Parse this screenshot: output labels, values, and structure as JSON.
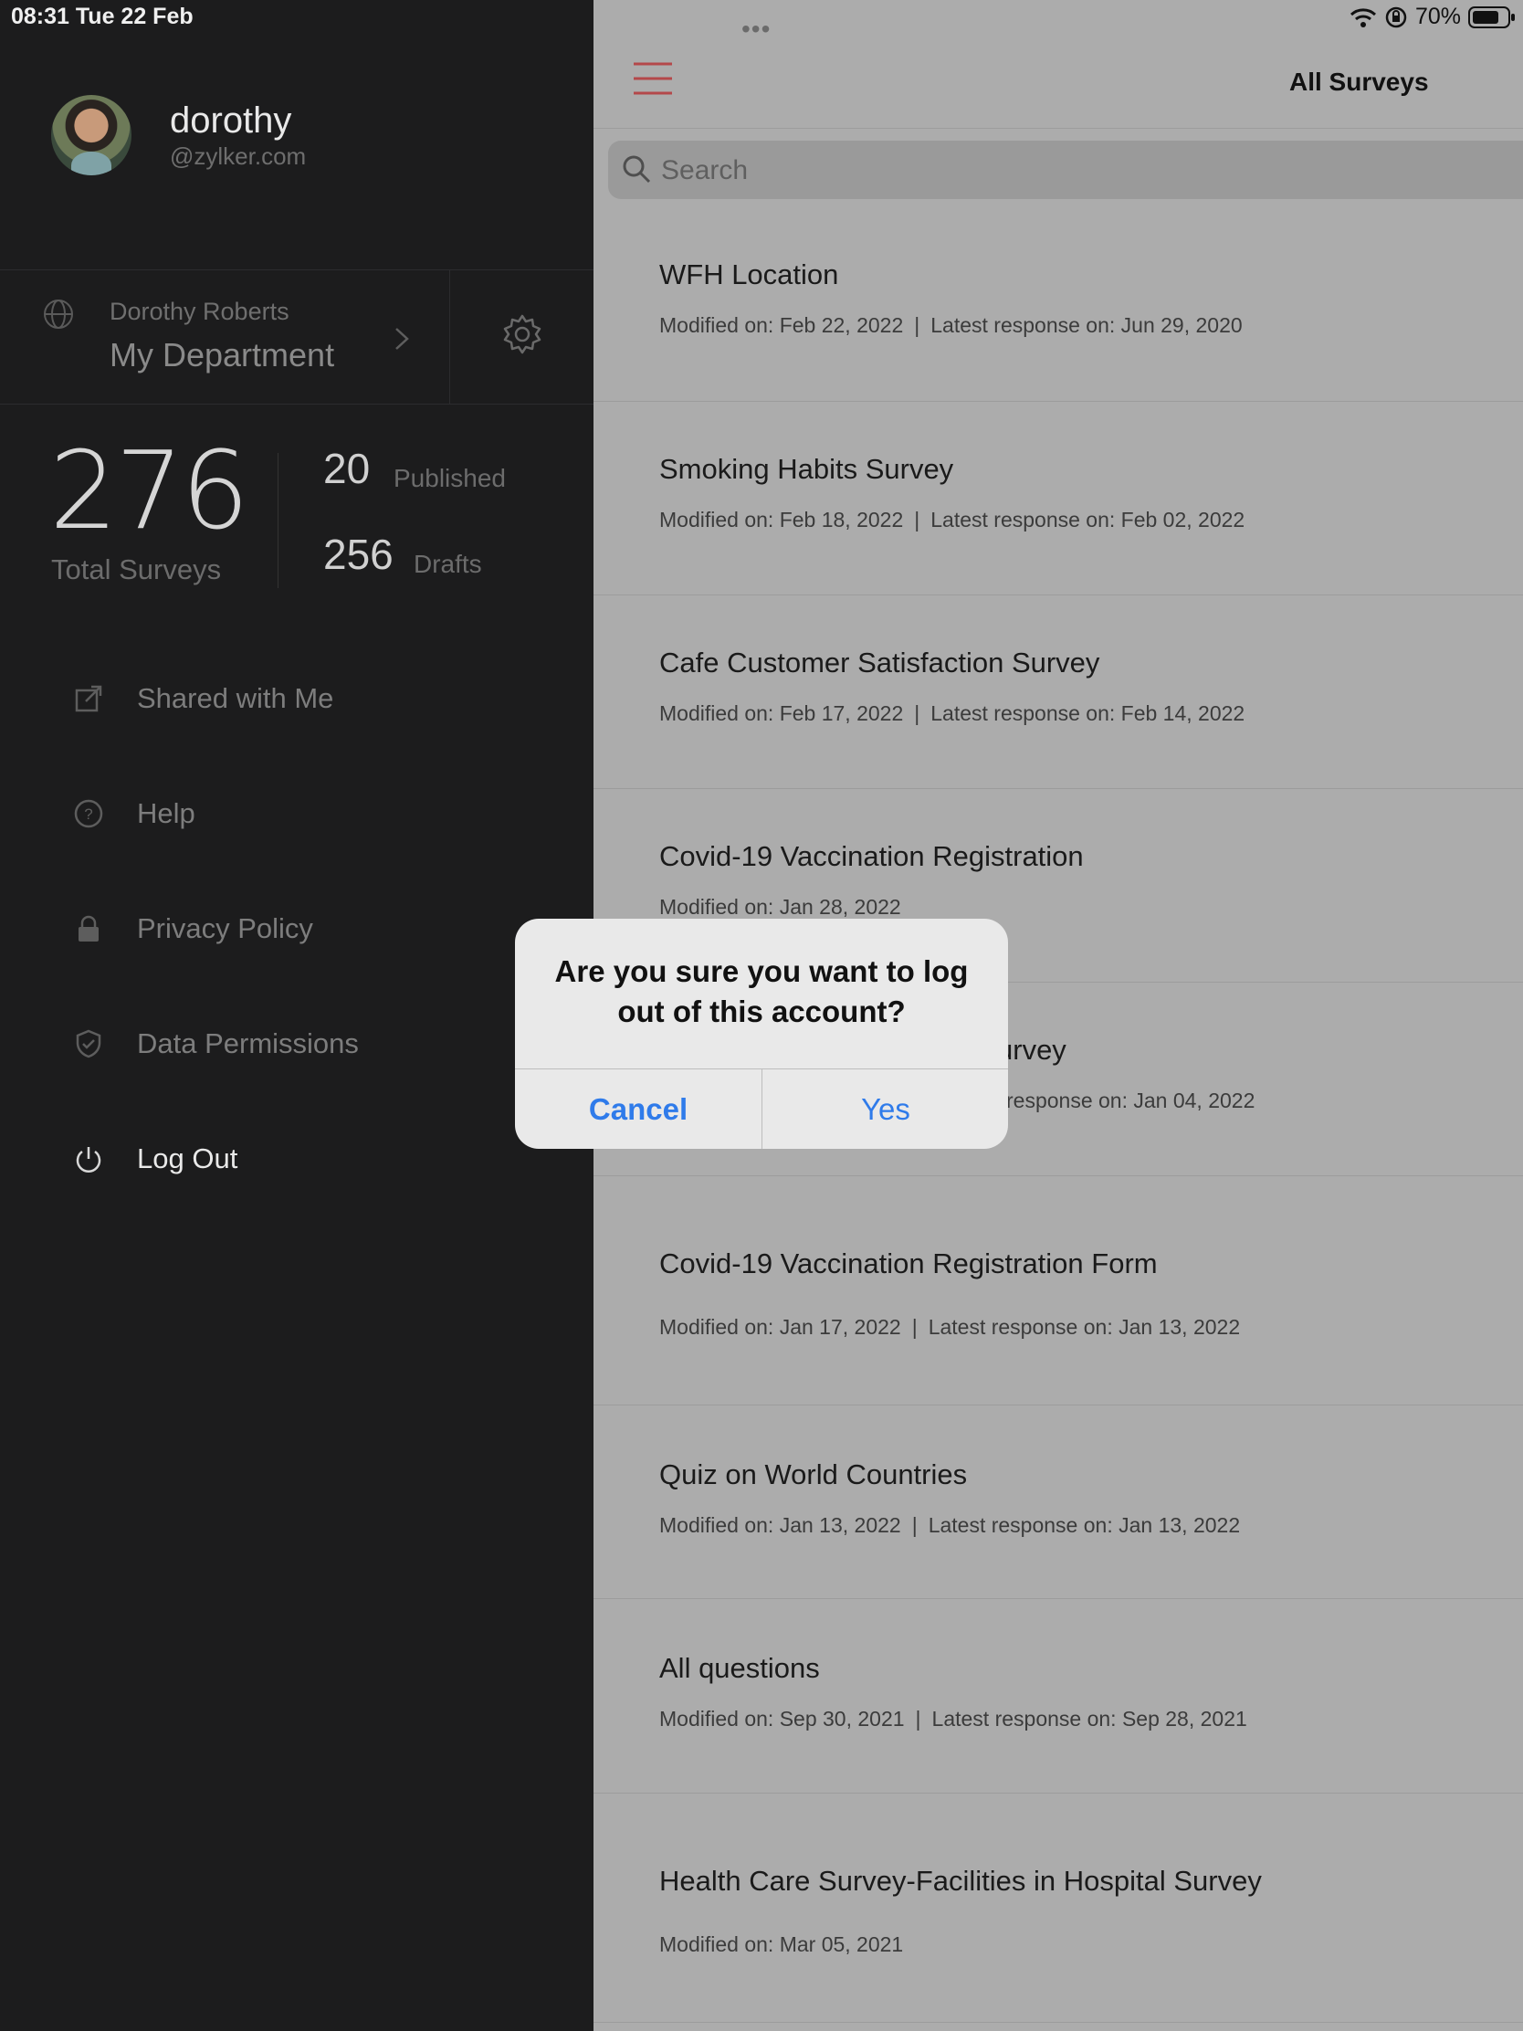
{
  "status_bar": {
    "time": "08:31   Tue 22 Feb",
    "battery": "70%"
  },
  "profile": {
    "name": "dorothy",
    "domain": "@zylker.com"
  },
  "department": {
    "owner": "Dorothy Roberts",
    "name": "My Department"
  },
  "stats": {
    "total": "276",
    "total_label": "Total Surveys",
    "published": "20",
    "published_label": "Published",
    "drafts": "256",
    "drafts_label": "Drafts"
  },
  "menu": [
    {
      "label": "Shared with Me",
      "icon": "share-icon"
    },
    {
      "label": "Help",
      "icon": "help-icon"
    },
    {
      "label": "Privacy Policy",
      "icon": "lock-icon"
    },
    {
      "label": "Data Permissions",
      "icon": "shield-icon"
    },
    {
      "label": "Log Out",
      "icon": "power-icon"
    }
  ],
  "header": {
    "title": "All Surveys",
    "grabber": "•••"
  },
  "search": {
    "placeholder": "Search"
  },
  "surveys": [
    {
      "title": "WFH Location",
      "modified": "Modified on: Feb 22, 2022",
      "latest": "Latest response on: Jun 29, 2020"
    },
    {
      "title": "Smoking Habits Survey",
      "modified": "Modified on: Feb 18, 2022",
      "latest": "Latest response on: Feb 02, 2022"
    },
    {
      "title": "Cafe Customer Satisfaction Survey",
      "modified": "Modified on: Feb 17, 2022",
      "latest": "Latest response on: Feb 14, 2022"
    },
    {
      "title": "Covid-19 Vaccination Registration",
      "modified": "Modified on: Jan 28, 2022",
      "latest": ""
    },
    {
      "title": "urvey",
      "modified": "",
      "latest": "response on: Jan 04, 2022"
    },
    {
      "title": "Covid-19 Vaccination Registration Form",
      "modified": "Modified on: Jan 17, 2022",
      "latest": "Latest response on: Jan 13, 2022"
    },
    {
      "title": "Quiz on World Countries",
      "modified": "Modified on: Jan 13, 2022",
      "latest": "Latest response on: Jan 13, 2022"
    },
    {
      "title": "All questions",
      "modified": "Modified on: Sep 30, 2021",
      "latest": "Latest response on: Sep 28, 2021"
    },
    {
      "title": "Health Care Survey-Facilities in Hospital Survey",
      "modified": "Modified on: Mar 05, 2021",
      "latest": ""
    }
  ],
  "dialog": {
    "message": "Are you sure you want to log out of this account?",
    "cancel_label": "Cancel",
    "confirm_label": "Yes"
  },
  "colors": {
    "accent": "#2f7bea",
    "hamburger": "#b4484a",
    "sidebar_bg": "#1c1c1d",
    "dim_bg": "#acacac"
  }
}
